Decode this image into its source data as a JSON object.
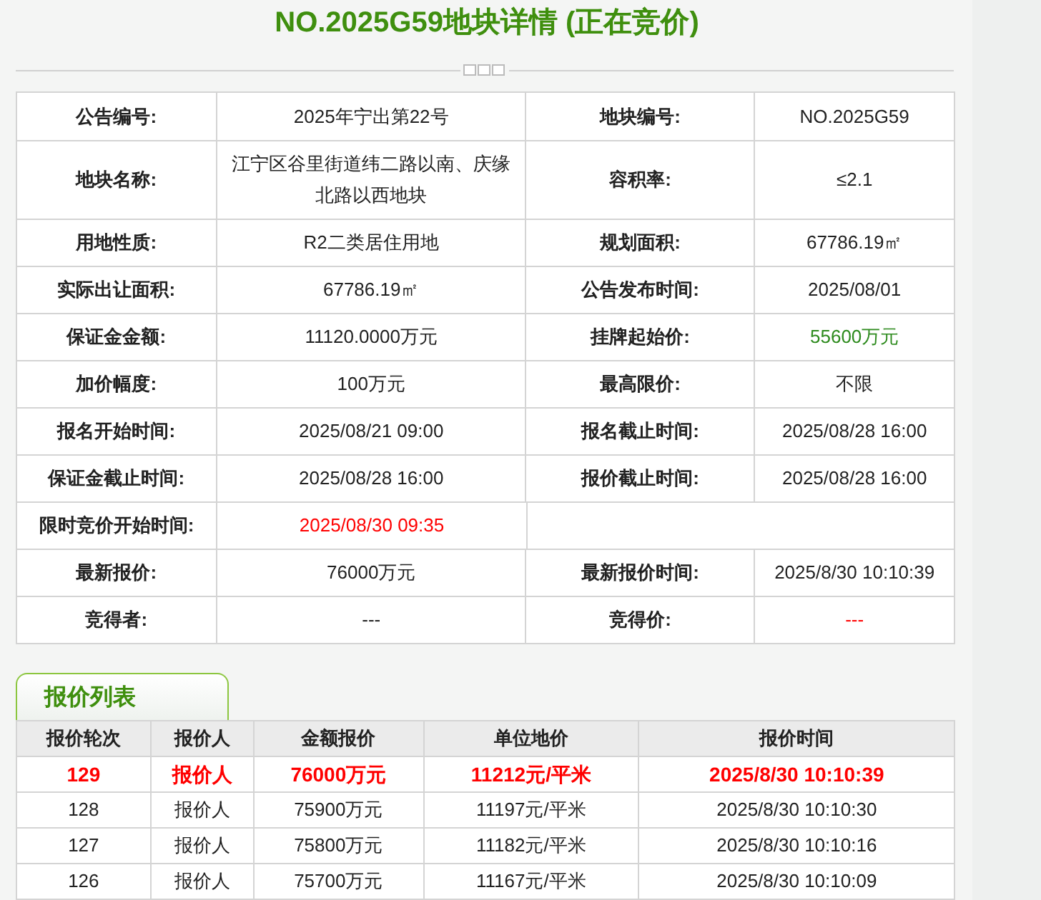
{
  "title": "NO.2025G59地块详情 (正在竞价)",
  "info_rows": [
    {
      "fields": [
        {
          "label": "公告编号:",
          "value": "2025年宁出第22号"
        },
        {
          "label": "地块编号:",
          "value": "NO.2025G59"
        }
      ]
    },
    {
      "fields": [
        {
          "label": "地块名称:",
          "value": "江宁区谷里街道纬二路以南、庆缘北路以西地块"
        },
        {
          "label": "容积率:",
          "value": "≤2.1"
        }
      ]
    },
    {
      "fields": [
        {
          "label": "用地性质:",
          "value": "R2二类居住用地"
        },
        {
          "label": "规划面积:",
          "value": "67786.19㎡"
        }
      ]
    },
    {
      "fields": [
        {
          "label": "实际出让面积:",
          "value": "67786.19㎡"
        },
        {
          "label": "公告发布时间:",
          "value": "2025/08/01"
        }
      ]
    },
    {
      "fields": [
        {
          "label": "保证金金额:",
          "value": "11120.0000万元"
        },
        {
          "label": "挂牌起始价:",
          "value": "55600万元",
          "color": "#2e8b1e"
        }
      ]
    },
    {
      "fields": [
        {
          "label": "加价幅度:",
          "value": "100万元"
        },
        {
          "label": "最高限价:",
          "value": "不限"
        }
      ]
    },
    {
      "fields": [
        {
          "label": "报名开始时间:",
          "value": "2025/08/21 09:00"
        },
        {
          "label": "报名截止时间:",
          "value": "2025/08/28 16:00"
        }
      ]
    },
    {
      "fields": [
        {
          "label": "保证金截止时间:",
          "value": "2025/08/28 16:00"
        },
        {
          "label": "报价截止时间:",
          "value": "2025/08/28 16:00"
        }
      ]
    },
    {
      "fields": [
        {
          "label": "限时竞价开始时间:",
          "value": "2025/08/30 09:35",
          "color": "#ff0000"
        }
      ]
    },
    {
      "fields": [
        {
          "label": "最新报价:",
          "value": "76000万元"
        },
        {
          "label": "最新报价时间:",
          "value": "2025/8/30 10:10:39"
        }
      ]
    },
    {
      "fields": [
        {
          "label": "竞得者:",
          "value": "---"
        },
        {
          "label": "竞得价:",
          "value": "---",
          "color": "#ff0000"
        }
      ]
    }
  ],
  "bids": {
    "tab": "报价列表",
    "columns": [
      "报价轮次",
      "报价人",
      "金额报价",
      "单位地价",
      "报价时间"
    ],
    "rows": [
      {
        "latest": true,
        "cells": [
          "129",
          "报价人",
          "76000万元",
          "11212元/平米",
          "2025/8/30 10:10:39"
        ]
      },
      {
        "latest": false,
        "cells": [
          "128",
          "报价人",
          "75900万元",
          "11197元/平米",
          "2025/8/30 10:10:30"
        ]
      },
      {
        "latest": false,
        "cells": [
          "127",
          "报价人",
          "75800万元",
          "11182元/平米",
          "2025/8/30 10:10:16"
        ]
      },
      {
        "latest": false,
        "cells": [
          "126",
          "报价人",
          "75700万元",
          "11167元/平米",
          "2025/8/30 10:10:09"
        ]
      }
    ]
  }
}
